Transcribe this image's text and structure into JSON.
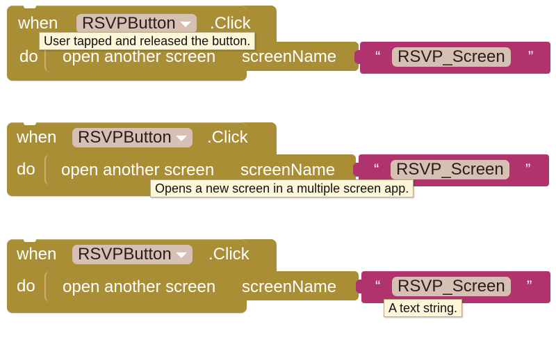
{
  "blocks": [
    {
      "when_label": "when",
      "component": "RSVPButton",
      "event": ".Click",
      "do_label": "do",
      "procedure": "open another screen",
      "param": "screenName",
      "open_quote": "“",
      "close_quote": "”",
      "text_value": "RSVP_Screen",
      "tooltip": "User tapped and released the button."
    },
    {
      "when_label": "when",
      "component": "RSVPButton",
      "event": ".Click",
      "do_label": "do",
      "procedure": "open another screen",
      "param": "screenName",
      "open_quote": "“",
      "close_quote": "”",
      "text_value": "RSVP_Screen",
      "tooltip": "Opens a new screen in a multiple screen app."
    },
    {
      "when_label": "when",
      "component": "RSVPButton",
      "event": ".Click",
      "do_label": "do",
      "procedure": "open another screen",
      "param": "screenName",
      "open_quote": "“",
      "close_quote": "”",
      "text_value": "RSVP_Screen",
      "tooltip": "A text string."
    }
  ],
  "colors": {
    "control_block": "#a98e35",
    "text_block": "#b1336e",
    "field": "#d6bfb3",
    "tooltip_bg": "#fdf6d8"
  }
}
